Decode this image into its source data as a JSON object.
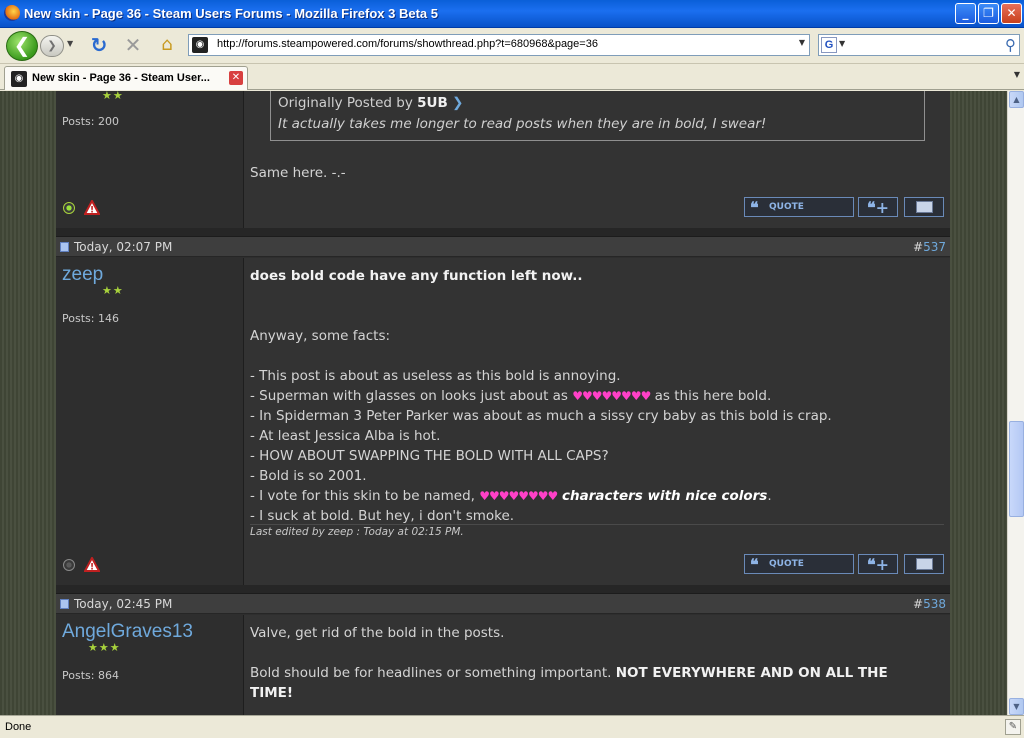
{
  "window": {
    "title": "New skin - Page 36 - Steam Users Forums - Mozilla Firefox 3 Beta 5",
    "minimize": "_",
    "maximize": "❐",
    "close": "✕"
  },
  "toolbar": {
    "back": "❮",
    "forward": "❯",
    "reload": "↻",
    "stop": "✕",
    "home": "⌂",
    "url": "http://forums.steampowered.com/forums/showthread.php?t=680968&page=36",
    "search_engine_icon": "G",
    "search_placeholder": "",
    "search_icon": "⚲"
  },
  "tabs": [
    {
      "title": "New skin - Page 36 - Steam User...",
      "close": "✕"
    }
  ],
  "posts": [
    {
      "stars": "★★",
      "post_count": "Posts: 200",
      "quote": {
        "prefix": "Originally Posted by ",
        "author": "5UB",
        "arrow": "❯",
        "text": "It actually takes me longer to read posts when they are in bold, I swear!"
      },
      "body": "Same here. -.-",
      "status": "online"
    },
    {
      "date": "Today, 02:07 PM",
      "number_prefix": "#",
      "number": "537",
      "username": "zeep",
      "stars": "★★",
      "post_count": "Posts: 146",
      "lines": [
        {
          "text": "does bold code have any function left now..",
          "bold": true
        },
        {
          "text": ""
        },
        {
          "text": ""
        },
        {
          "text": "Anyway, some facts:"
        },
        {
          "text": ""
        },
        {
          "text": "- This post is about as useless as this bold is annoying."
        },
        {
          "pre": "- Superman with glasses on looks just about as ",
          "hearts": "♥♥♥♥♥♥♥♥",
          "post": " as this here bold."
        },
        {
          "text": "- In Spiderman 3 Peter Parker was about as much a sissy cry baby as this bold is crap."
        },
        {
          "text": "- At least Jessica Alba is hot."
        },
        {
          "text": "- HOW ABOUT SWAPPING THE BOLD WITH ALL CAPS?"
        },
        {
          "text": "- Bold is so 2001."
        },
        {
          "pre": "- I vote for this skin to be named, ",
          "hearts": "♥♥♥♥♥♥♥♥",
          "emph": " characters with nice colors",
          "post": "."
        },
        {
          "text": "- I suck at bold. But hey, i don't smoke."
        }
      ],
      "edited_note": "Last edited by zeep : Today at 02:15 PM.",
      "status": "offline"
    },
    {
      "date": "Today, 02:45 PM",
      "number_prefix": "#",
      "number": "538",
      "username": "AngelGraves13",
      "stars": "★★★",
      "post_count": "Posts: 864",
      "line1": "Valve, get rid of the bold in the posts.",
      "line2_pre": "Bold should be for headlines or something important. ",
      "line2_bold": "NOT EVERYWHERE AND ON ALL THE",
      "line3_bold": "TIME!"
    }
  ],
  "buttons": {
    "quote_label": "QUOTE",
    "quote_mark": "❝",
    "multi_quote": "❝+"
  },
  "report_icon": "⚠",
  "status_bar": {
    "text": "Done"
  }
}
